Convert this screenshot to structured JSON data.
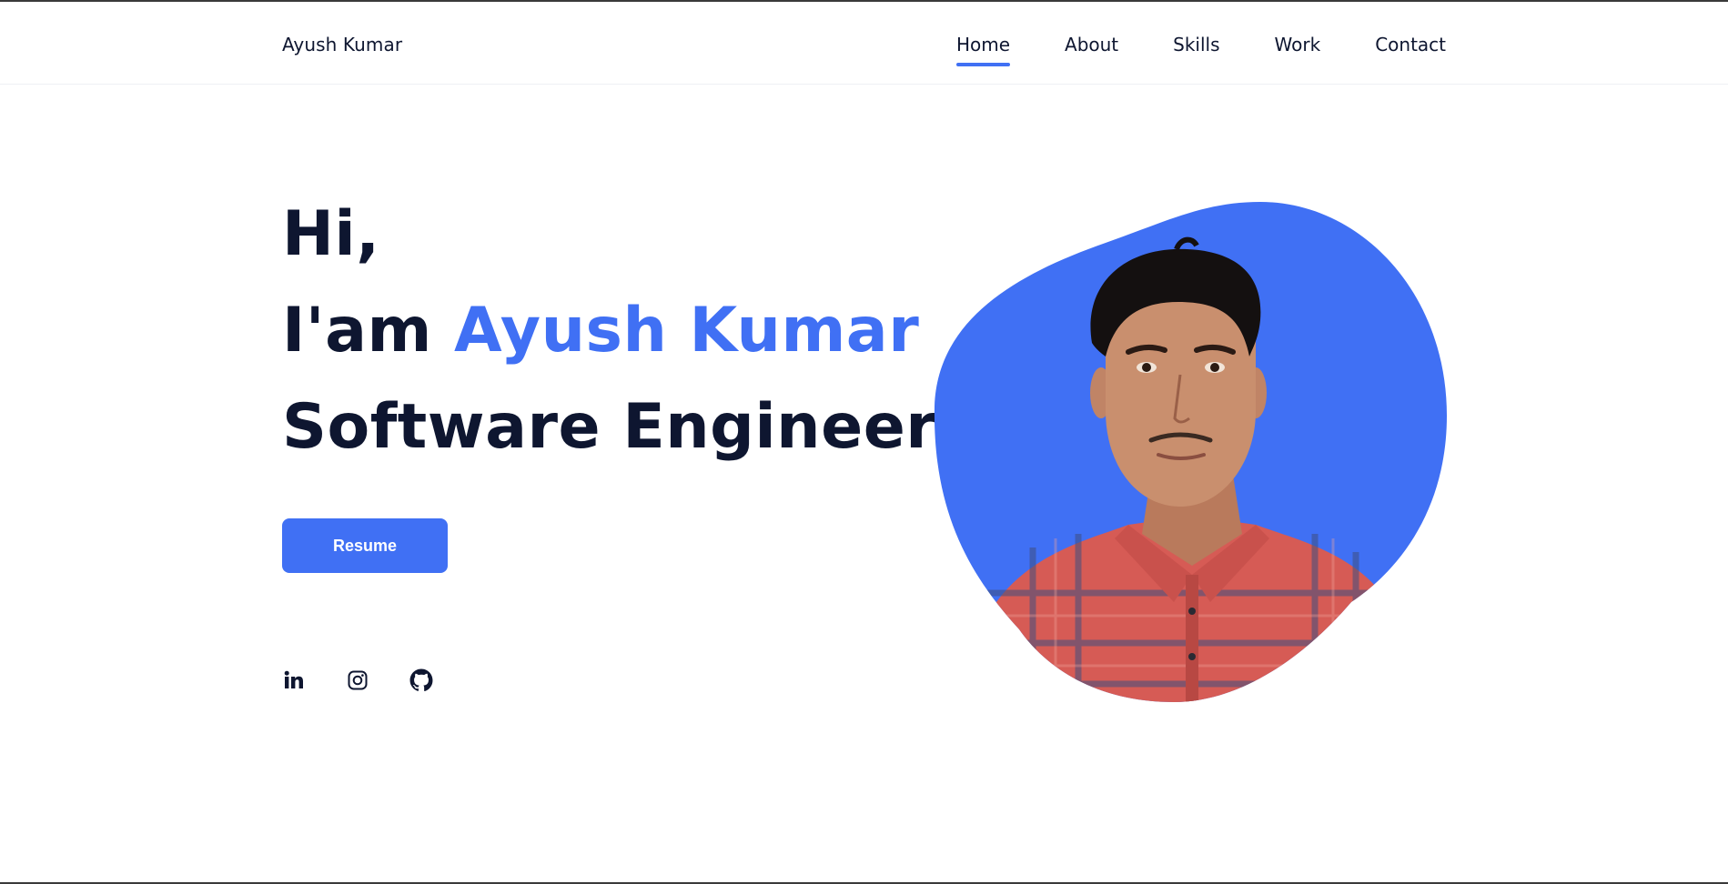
{
  "brand": "Ayush Kumar",
  "nav": {
    "items": [
      {
        "label": "Home",
        "active": true
      },
      {
        "label": "About",
        "active": false
      },
      {
        "label": "Skills",
        "active": false
      },
      {
        "label": "Work",
        "active": false
      },
      {
        "label": "Contact",
        "active": false
      }
    ]
  },
  "hero": {
    "greeting": "Hi,",
    "intro_prefix": "I'am ",
    "name": "Ayush Kumar",
    "role": "Software Engineer",
    "resume_label": "Resume"
  },
  "socials": [
    {
      "icon": "linkedin-icon"
    },
    {
      "icon": "instagram-icon"
    },
    {
      "icon": "github-icon"
    }
  ],
  "colors": {
    "accent": "#4070f4",
    "text": "#0e1630",
    "shirt": "#d65b55",
    "skin": "#c98f6e",
    "hair": "#141010"
  }
}
